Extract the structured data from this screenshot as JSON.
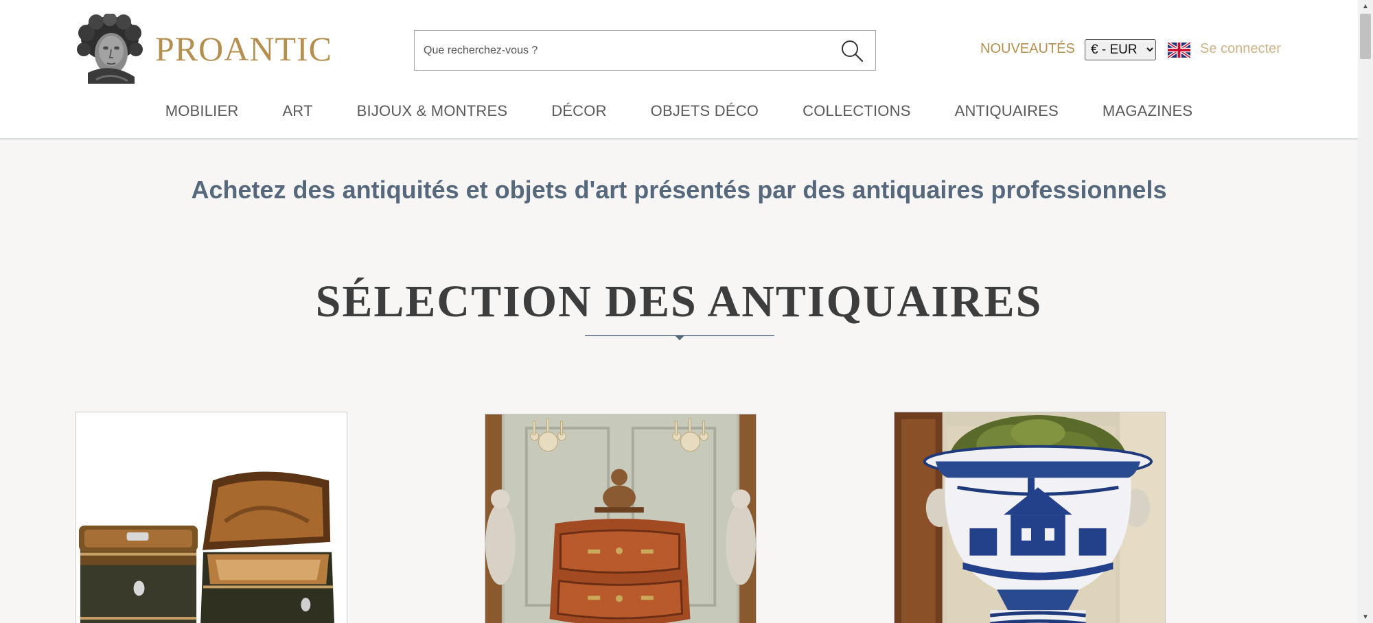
{
  "header": {
    "logo_text": "PROANTIC",
    "search": {
      "placeholder": "Que recherchez-vous ?",
      "value": ""
    },
    "nouveautes_label": "NOUVEAUTÉS",
    "currency": {
      "selected": "€ - EUR",
      "options": [
        "€ - EUR"
      ]
    },
    "language_flag": "uk-flag-icon",
    "login_label": "Se connecter"
  },
  "nav": {
    "items": [
      {
        "label": "MOBILIER"
      },
      {
        "label": "ART"
      },
      {
        "label": "BIJOUX & MONTRES"
      },
      {
        "label": "DÉCOR"
      },
      {
        "label": "OBJETS DÉCO"
      },
      {
        "label": "COLLECTIONS"
      },
      {
        "label": "ANTIQUAIRES"
      },
      {
        "label": "MAGAZINES"
      }
    ]
  },
  "main": {
    "tagline": "Achetez des antiquités et objets d'art présentés par des antiquaires professionnels",
    "section_title": "SÉLECTION DES ANTIQUAIRES",
    "cards": [
      {
        "image": "marquetry-boxes-image"
      },
      {
        "image": "louis-xv-commode-image"
      },
      {
        "image": "blue-white-faience-vase-image"
      }
    ]
  },
  "colors": {
    "brand_gold": "#b48f4f",
    "login_gold": "#cdb488",
    "tagline_slate": "#56687c",
    "nav_text": "#595959",
    "page_bg": "#f7f6f5"
  }
}
